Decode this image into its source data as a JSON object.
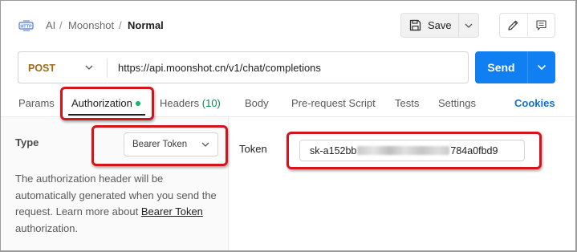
{
  "breadcrumb": {
    "items": [
      "AI",
      "Moonshot"
    ],
    "current": "Normal",
    "separator": "/"
  },
  "toolbar": {
    "save_label": "Save"
  },
  "request": {
    "method": "POST",
    "url": "https://api.moonshot.cn/v1/chat/completions",
    "send_label": "Send"
  },
  "tabs": {
    "params": "Params",
    "authorization": "Authorization",
    "headers": "Headers",
    "headers_count": "(10)",
    "body": "Body",
    "prerequest": "Pre-request Script",
    "tests": "Tests",
    "settings": "Settings",
    "cookies": "Cookies"
  },
  "auth": {
    "type_label": "Type",
    "type_value": "Bearer Token",
    "description_pre": "The authorization header will be automatically generated when you send the request. Learn more about ",
    "description_link": "Bearer Token",
    "description_post": " authorization.",
    "token_label": "Token",
    "token_prefix": "sk-a152bb",
    "token_suffix": "784a0fbd9"
  },
  "colors": {
    "send_button": "#0f7ff2",
    "method_post": "#a1691a",
    "annotation": "#d3141d",
    "auth_dot": "#0cba6a",
    "headers_count": "#0b8a4a",
    "cookies": "#0f6fd6"
  },
  "icons": {
    "http": "http-icon",
    "save": "save-icon",
    "edit": "pencil-icon",
    "comments": "comment-icon"
  }
}
